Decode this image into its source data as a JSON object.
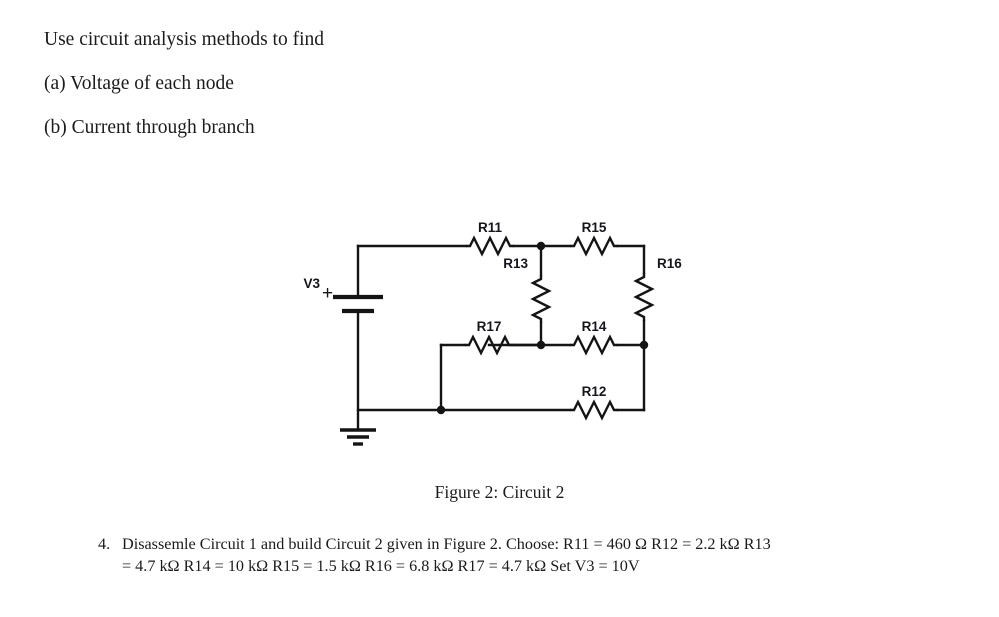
{
  "prompt": {
    "lines": [
      "Use circuit analysis methods to find",
      "(a) Voltage of each node",
      "(b) Current through branch"
    ]
  },
  "figure": {
    "caption": "Figure 2:  Circuit 2",
    "source_label": "V3",
    "source_polarity": "+",
    "ground_icon": "ground-icon",
    "resistor_labels": {
      "r11": "R11",
      "r12": "R12",
      "r13": "R13",
      "r14": "R14",
      "r15": "R15",
      "r16": "R16",
      "r17": "R17"
    },
    "colors": {
      "wire": "#141414",
      "label": "#15161c",
      "background": "#ffffff"
    }
  },
  "problem": {
    "number": "4.",
    "line1": "Disassemle Circuit 1 and build Circuit 2 given in Figure 2.  Choose:  R11 = 460 Ω R12 = 2.2 kΩ R13",
    "line2": "= 4.7 kΩ R14 = 10 kΩ R15 = 1.5 kΩ R16 = 6.8 kΩ R17 = 4.7 kΩ Set V3 = 10V",
    "values": {
      "R11": "460 Ω",
      "R12": "2.2 kΩ",
      "R13": "4.7 kΩ",
      "R14": "10 kΩ",
      "R15": "1.5 kΩ",
      "R16": "6.8 kΩ",
      "R17": "4.7 kΩ",
      "V3": "10V"
    }
  }
}
